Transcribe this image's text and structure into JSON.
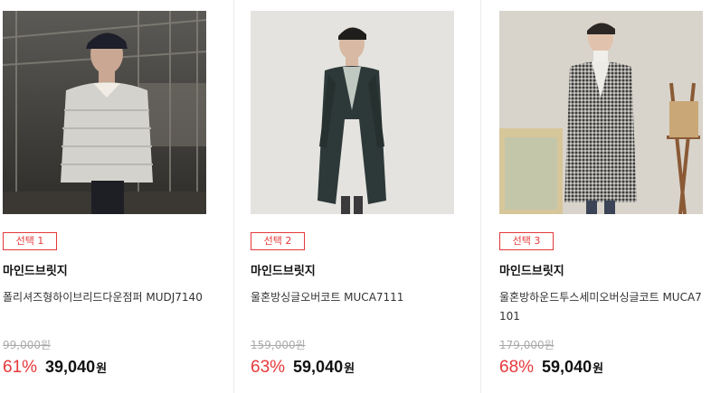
{
  "products": [
    {
      "select_label": "선택 1",
      "brand": "마인드브릿지",
      "name": "폴리셔즈형하이브리드다운점퍼 MUDJ7140",
      "original_price": "99,000원",
      "discount": "61%",
      "sale_price": "39,040",
      "currency": "원",
      "image_subject": "man-in-light-grey-quilted-down-jacket"
    },
    {
      "select_label": "선택 2",
      "brand": "마인드브릿지",
      "name": "울혼방싱글오버코트 MUCA7111",
      "original_price": "159,000원",
      "discount": "63%",
      "sale_price": "59,040",
      "currency": "원",
      "image_subject": "man-in-dark-green-long-overcoat"
    },
    {
      "select_label": "선택 3",
      "brand": "마인드브릿지",
      "name": "울혼방하운드투스세미오버싱글코트 MUCA7101",
      "original_price": "179,000원",
      "discount": "68%",
      "sale_price": "59,040",
      "currency": "원",
      "image_subject": "man-in-houndstooth-overcoat"
    }
  ],
  "colors": {
    "accent": "#e5393a",
    "strike": "#aaaaaa",
    "text": "#111111"
  }
}
